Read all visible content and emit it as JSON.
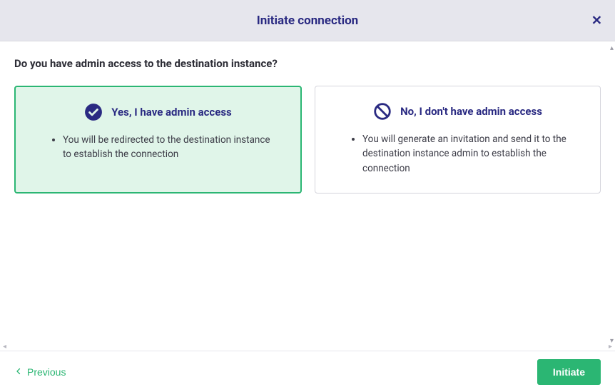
{
  "header": {
    "title": "Initiate connection"
  },
  "question": "Do you have admin access to the destination instance?",
  "options": {
    "yes": {
      "title": "Yes, I have admin access",
      "desc": "You will be redirected to the destination instance to establish the connection"
    },
    "no": {
      "title": "No, I don't have admin access",
      "desc": "You will generate an invitation and send it to the destination instance admin to establish the connection"
    }
  },
  "footer": {
    "previous": "Previous",
    "initiate": "Initiate"
  }
}
